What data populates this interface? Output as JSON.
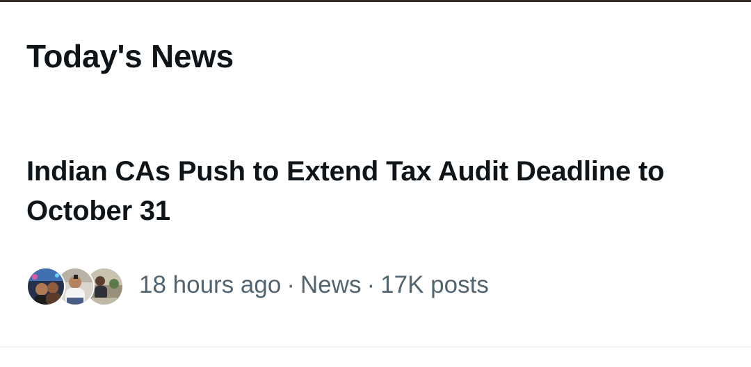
{
  "section": {
    "title": "Today's News"
  },
  "news_item": {
    "headline": "Indian CAs Push to Extend Tax Audit Deadline to October 31",
    "time_ago": "18 hours ago",
    "category": "News",
    "post_count": "17K posts",
    "separator": "·",
    "avatars": [
      "avatar-1",
      "avatar-2",
      "avatar-3"
    ]
  },
  "colors": {
    "text_primary": "#0f1419",
    "text_secondary": "#536471",
    "divider": "#eff3f4",
    "background": "#ffffff"
  }
}
